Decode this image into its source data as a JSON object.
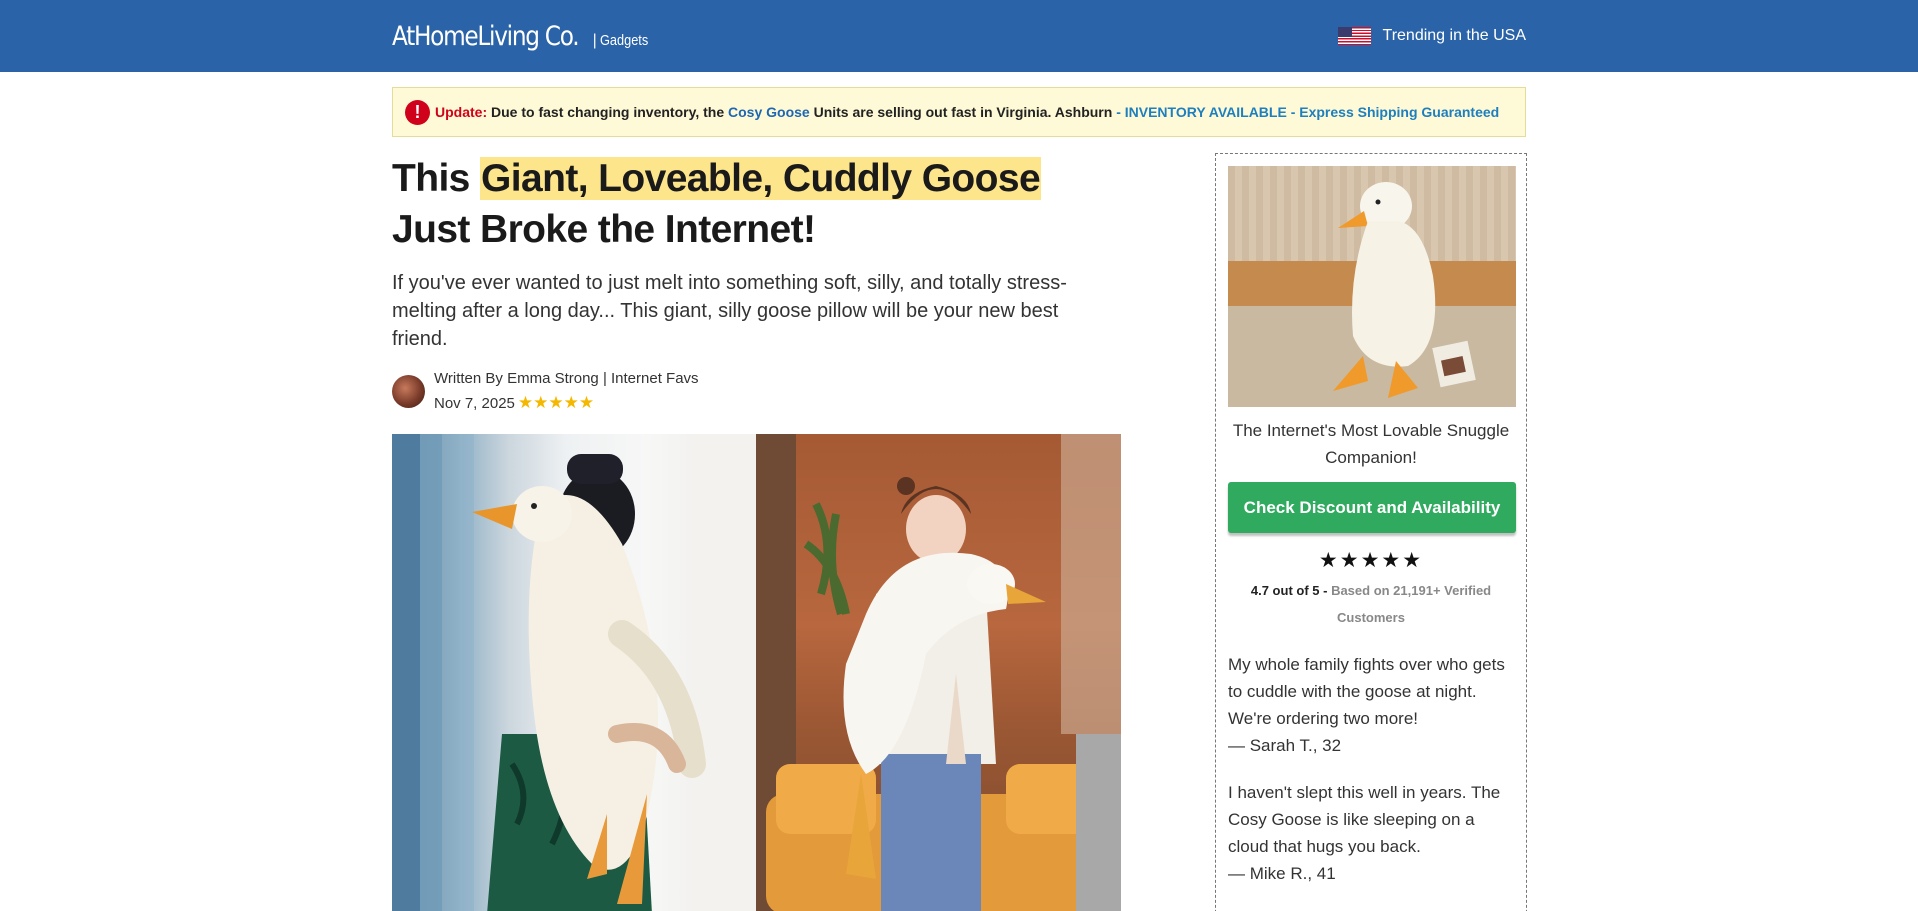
{
  "header": {
    "brand_name": "AtHomeLiving Co.",
    "brand_separator": "|",
    "brand_tag": "Gadgets",
    "trending_text": "Trending in the USA",
    "flag_icon": "us-flag-icon",
    "background_color": "#2a63a8"
  },
  "alert": {
    "icon": "exclamation-icon",
    "label": "Update:",
    "text_1": "Due to fast changing inventory, the",
    "product_link": "Cosy Goose",
    "text_2": "Units are selling out fast in Virginia. Ashburn",
    "status": "- INVENTORY AVAILABLE - Express Shipping Guaranteed"
  },
  "article": {
    "headline_pre": "This",
    "headline_highlight": "Giant, Loveable, Cuddly Goose",
    "headline_post": "Just Broke the Internet!",
    "subhead": "If you've ever wanted to just melt into something soft, silly, and totally stress-melting after a long day... This giant, silly goose pillow will be your new best friend.",
    "author_line": "Written By Emma Strong | Internet Favs",
    "date": "Nov 7, 2025",
    "stars": "★★★★★",
    "rating": 5
  },
  "sidebar": {
    "caption": "The Internet's Most Lovable Snuggle Companion!",
    "cta_label": "Check Discount and Availability",
    "cta_color": "#2faa5f",
    "stars": "★★★★★",
    "rating_strong": "4.7 out of 5 -",
    "rating_muted": "Based on 21,191+ Verified Customers",
    "reviews": [
      {
        "text": "My whole family fights over who gets to cuddle with the goose at night. We're ordering two more!",
        "author": "— Sarah T., 32"
      },
      {
        "text": "I haven't slept this well in years. The Cosy Goose is like sleeping on a cloud that hugs you back.",
        "author": "— Mike R., 41"
      }
    ]
  }
}
